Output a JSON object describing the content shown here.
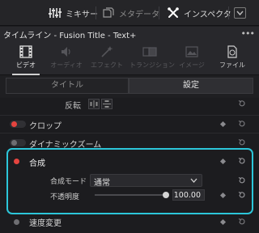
{
  "toolbar": {
    "mixer": "ミキサー",
    "metadata": "メタデータ",
    "inspector": "インスペクタ"
  },
  "titlebar": {
    "title": "タイムライン - Fusion Title - Text+"
  },
  "tabs": [
    {
      "label": "ビデオ",
      "state": "active"
    },
    {
      "label": "オーディオ",
      "state": "disabled"
    },
    {
      "label": "エフェクト",
      "state": "disabled"
    },
    {
      "label": "トランジション",
      "state": "disabled"
    },
    {
      "label": "イメージ",
      "state": "disabled"
    },
    {
      "label": "ファイル",
      "state": "enabled"
    }
  ],
  "segments": {
    "title": "タイトル",
    "settings": "設定",
    "selected": "settings"
  },
  "list": {
    "flip_label": "反転",
    "crop": {
      "label": "クロップ",
      "enabled": true
    },
    "dynamic_zoom": {
      "label": "ダイナミックズーム",
      "enabled": false
    },
    "composite": {
      "label": "合成",
      "enabled": true,
      "mode_label": "合成モード",
      "mode_value": "通常",
      "opacity_label": "不透明度",
      "opacity_value": "100.00"
    },
    "speed_change": "速度変更"
  },
  "colors": {
    "accent_highlight": "#2cc6d9",
    "toggle_on": "#e5443f"
  }
}
